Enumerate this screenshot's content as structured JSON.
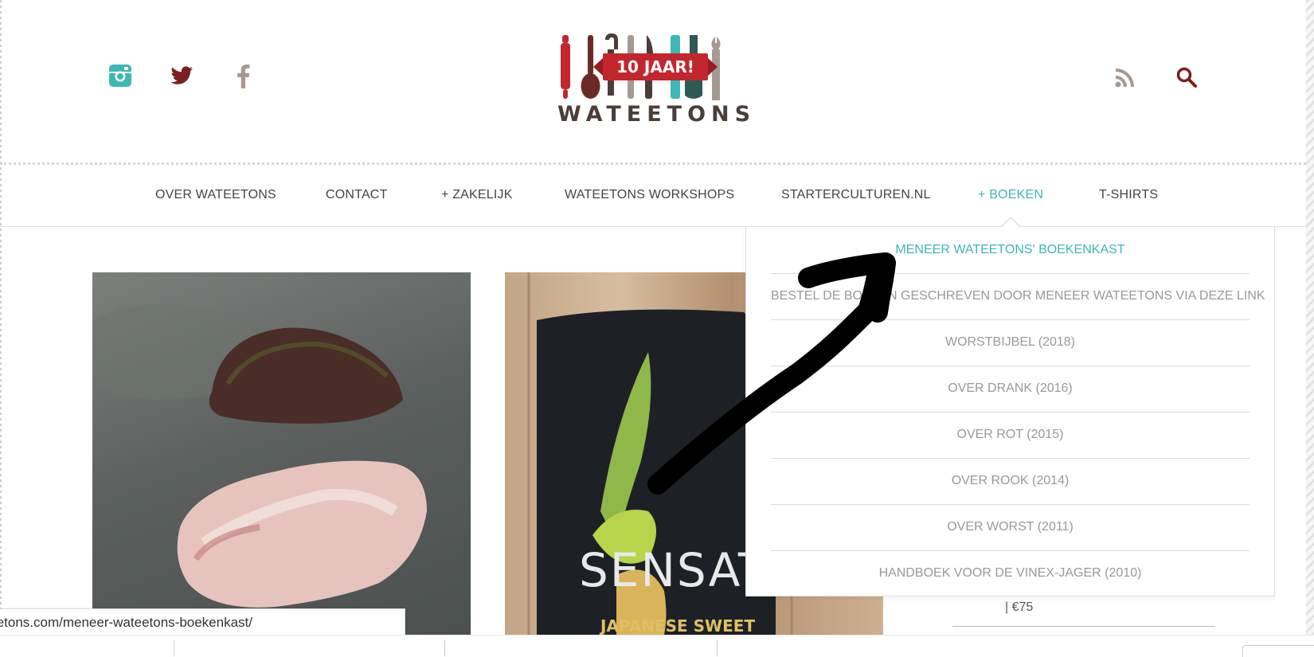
{
  "header": {
    "social": [
      {
        "icon": "instagram-icon",
        "color": "#3eb8b4"
      },
      {
        "icon": "twitter-icon",
        "color": "#7a2020"
      },
      {
        "icon": "facebook-icon",
        "color": "#a59a93"
      }
    ],
    "utility": [
      {
        "icon": "rss-icon",
        "color": "#a59a93"
      },
      {
        "icon": "search-icon",
        "color": "#7a2020"
      }
    ],
    "logo": {
      "banner": "10 JAAR!",
      "title": "WATEETONS"
    }
  },
  "nav": {
    "items": [
      {
        "label": "OVER WATEETONS"
      },
      {
        "label": "CONTACT"
      },
      {
        "label": "+ ZAKELIJK"
      },
      {
        "label": "WATEETONS WORKSHOPS"
      },
      {
        "label": "STARTERCULTUREN.NL"
      },
      {
        "label": "+ BOEKEN",
        "active": true
      },
      {
        "label": "T-SHIRTS"
      }
    ]
  },
  "dropdown": {
    "items": [
      {
        "label": "MENEER WATEETONS' BOEKENKAST",
        "active": true
      },
      {
        "label": "BESTEL DE BOEKEN GESCHREVEN DOOR MENEER WATEETONS VIA DEZE LINK"
      },
      {
        "label": "WORSTBIJBEL (2018)"
      },
      {
        "label": "OVER DRANK (2016)"
      },
      {
        "label": "OVER ROT (2015)"
      },
      {
        "label": "OVER ROOK (2014)"
      },
      {
        "label": "OVER WORST (2011)"
      },
      {
        "label": "HANDBOEK VOOR DE VINEX-JAGER (2010)"
      }
    ]
  },
  "sidebar": {
    "price": "| €75"
  },
  "content": {
    "photo2_text": "SENSATI",
    "photo2_subtext": "JAPANESE SWEET"
  },
  "status_bar": {
    "url": "https://wateetons.com/meneer-wateetons-boekenkast/"
  },
  "colors": {
    "accent": "#3eb8b4",
    "brand_red": "#c4262e",
    "brown": "#4a3e3a"
  }
}
